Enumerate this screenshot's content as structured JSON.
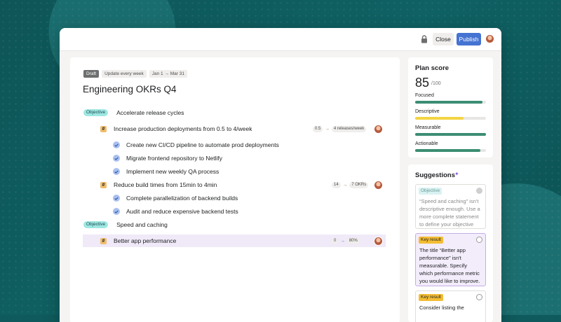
{
  "toolbar": {
    "close_label": "Close",
    "publish_label": "Publish",
    "lock_icon": "lock-icon"
  },
  "header": {
    "tags": [
      "Draft",
      "Update every week",
      "Jan 1 → Mar 31"
    ],
    "title": "Engineering OKRs Q4"
  },
  "outline": {
    "objectives": [
      {
        "pill": "Objective",
        "label": "Accelerate release cycles",
        "key_results": [
          {
            "label": "Increase production deployments from 0.5 to 4/week",
            "start": "0.5",
            "target": "4 releases/week",
            "tasks": [
              "Create new CI/CD pipeline to automate prod deployments",
              "Migrate frontend repository to Netlify",
              "Implement new weekly QA process"
            ]
          },
          {
            "label": "Reduce build times from 15min to 4min",
            "start": "14",
            "target": "7 OKRs",
            "tasks": [
              "Complete parallelization of backend builds",
              "Audit and reduce expensive backend tests"
            ]
          }
        ]
      },
      {
        "pill": "Objective",
        "label": "Speed and caching",
        "key_results": [
          {
            "label": "Better app performance",
            "start": "0",
            "target": "80%",
            "tasks": []
          }
        ]
      }
    ],
    "kr_symbol": "#"
  },
  "plan_score": {
    "title": "Plan score",
    "score": "85",
    "max": "/100",
    "metrics": [
      {
        "label": "Focused",
        "level": 0.95,
        "color": "#3b8d73"
      },
      {
        "label": "Descriptive",
        "level": 0.68,
        "color": "#f3d543"
      },
      {
        "label": "Measurable",
        "level": 1.0,
        "color": "#3b8d73"
      },
      {
        "label": "Actionable",
        "level": 0.92,
        "color": "#3b8d73"
      }
    ]
  },
  "suggestions": {
    "title": "Suggestions",
    "sparkle_icon": "sparkle-icon",
    "items": [
      {
        "tag": "Objective",
        "text": "“Speed and caching” isn't descriptive enough. Use a more complete statement to define your objective",
        "state": "done"
      },
      {
        "tag": "Key result",
        "text": "The title “Better app performance” isn't measurable. Specify which performance metric you would like to improve.",
        "state": "active"
      },
      {
        "tag": "Key result",
        "text": "Consider listing the",
        "state": "open"
      }
    ]
  }
}
